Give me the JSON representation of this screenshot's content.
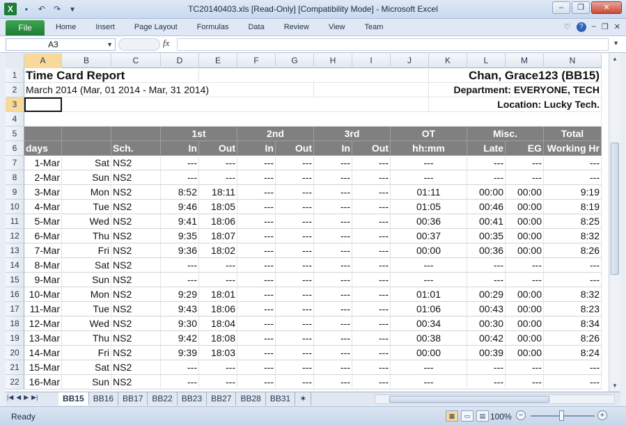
{
  "window": {
    "title": "TC20140403.xls  [Read-Only]  [Compatibility Mode]  -  Microsoft Excel",
    "app_icon_letter": "X"
  },
  "ribbon": {
    "file_label": "File",
    "tabs": [
      "Home",
      "Insert",
      "Page Layout",
      "Formulas",
      "Data",
      "Review",
      "View",
      "Team"
    ]
  },
  "formula_bar": {
    "name_box": "A3",
    "fx_label": "fx",
    "value": ""
  },
  "columns": [
    "A",
    "B",
    "C",
    "D",
    "E",
    "F",
    "G",
    "H",
    "I",
    "J",
    "K",
    "L",
    "M",
    "N"
  ],
  "report": {
    "title": "Time Card Report",
    "period": "March 2014 (Mar, 01 2014 - Mar, 31 2014)",
    "employee": "Chan, Grace123 (BB15)",
    "department": "Department: EVERYONE, TECH",
    "location": "Location: Lucky Tech."
  },
  "header_row5": {
    "first": "1st",
    "second": "2nd",
    "third": "3rd",
    "ot": "OT",
    "misc": "Misc.",
    "total": "Total"
  },
  "header_row6": {
    "days": "days",
    "sch": "Sch.",
    "in1": "In",
    "out1": "Out",
    "in2": "In",
    "out2": "Out",
    "in3": "In",
    "out3": "Out",
    "hhmm": "hh:mm",
    "late": "Late",
    "eg": "EG",
    "working": "Working Hr"
  },
  "rows": [
    {
      "n": "7",
      "date": "1-Mar",
      "day": "Sat",
      "sch": "NS2",
      "in1": "---",
      "out1": "---",
      "in2": "---",
      "out2": "---",
      "in3": "---",
      "out3": "---",
      "ot": "---",
      "late": "---",
      "eg": "---",
      "total": "---"
    },
    {
      "n": "8",
      "date": "2-Mar",
      "day": "Sun",
      "sch": "NS2",
      "in1": "---",
      "out1": "---",
      "in2": "---",
      "out2": "---",
      "in3": "---",
      "out3": "---",
      "ot": "---",
      "late": "---",
      "eg": "---",
      "total": "---"
    },
    {
      "n": "9",
      "date": "3-Mar",
      "day": "Mon",
      "sch": "NS2",
      "in1": "8:52",
      "out1": "18:11",
      "in2": "---",
      "out2": "---",
      "in3": "---",
      "out3": "---",
      "ot": "01:11",
      "late": "00:00",
      "eg": "00:00",
      "total": "9:19"
    },
    {
      "n": "10",
      "date": "4-Mar",
      "day": "Tue",
      "sch": "NS2",
      "in1": "9:46",
      "out1": "18:05",
      "in2": "---",
      "out2": "---",
      "in3": "---",
      "out3": "---",
      "ot": "01:05",
      "late": "00:46",
      "eg": "00:00",
      "total": "8:19"
    },
    {
      "n": "11",
      "date": "5-Mar",
      "day": "Wed",
      "sch": "NS2",
      "in1": "9:41",
      "out1": "18:06",
      "in2": "---",
      "out2": "---",
      "in3": "---",
      "out3": "---",
      "ot": "00:36",
      "late": "00:41",
      "eg": "00:00",
      "total": "8:25"
    },
    {
      "n": "12",
      "date": "6-Mar",
      "day": "Thu",
      "sch": "NS2",
      "in1": "9:35",
      "out1": "18:07",
      "in2": "---",
      "out2": "---",
      "in3": "---",
      "out3": "---",
      "ot": "00:37",
      "late": "00:35",
      "eg": "00:00",
      "total": "8:32"
    },
    {
      "n": "13",
      "date": "7-Mar",
      "day": "Fri",
      "sch": "NS2",
      "in1": "9:36",
      "out1": "18:02",
      "in2": "---",
      "out2": "---",
      "in3": "---",
      "out3": "---",
      "ot": "00:00",
      "late": "00:36",
      "eg": "00:00",
      "total": "8:26"
    },
    {
      "n": "14",
      "date": "8-Mar",
      "day": "Sat",
      "sch": "NS2",
      "in1": "---",
      "out1": "---",
      "in2": "---",
      "out2": "---",
      "in3": "---",
      "out3": "---",
      "ot": "---",
      "late": "---",
      "eg": "---",
      "total": "---"
    },
    {
      "n": "15",
      "date": "9-Mar",
      "day": "Sun",
      "sch": "NS2",
      "in1": "---",
      "out1": "---",
      "in2": "---",
      "out2": "---",
      "in3": "---",
      "out3": "---",
      "ot": "---",
      "late": "---",
      "eg": "---",
      "total": "---"
    },
    {
      "n": "16",
      "date": "10-Mar",
      "day": "Mon",
      "sch": "NS2",
      "in1": "9:29",
      "out1": "18:01",
      "in2": "---",
      "out2": "---",
      "in3": "---",
      "out3": "---",
      "ot": "01:01",
      "late": "00:29",
      "eg": "00:00",
      "total": "8:32"
    },
    {
      "n": "17",
      "date": "11-Mar",
      "day": "Tue",
      "sch": "NS2",
      "in1": "9:43",
      "out1": "18:06",
      "in2": "---",
      "out2": "---",
      "in3": "---",
      "out3": "---",
      "ot": "01:06",
      "late": "00:43",
      "eg": "00:00",
      "total": "8:23"
    },
    {
      "n": "18",
      "date": "12-Mar",
      "day": "Wed",
      "sch": "NS2",
      "in1": "9:30",
      "out1": "18:04",
      "in2": "---",
      "out2": "---",
      "in3": "---",
      "out3": "---",
      "ot": "00:34",
      "late": "00:30",
      "eg": "00:00",
      "total": "8:34"
    },
    {
      "n": "19",
      "date": "13-Mar",
      "day": "Thu",
      "sch": "NS2",
      "in1": "9:42",
      "out1": "18:08",
      "in2": "---",
      "out2": "---",
      "in3": "---",
      "out3": "---",
      "ot": "00:38",
      "late": "00:42",
      "eg": "00:00",
      "total": "8:26"
    },
    {
      "n": "20",
      "date": "14-Mar",
      "day": "Fri",
      "sch": "NS2",
      "in1": "9:39",
      "out1": "18:03",
      "in2": "---",
      "out2": "---",
      "in3": "---",
      "out3": "---",
      "ot": "00:00",
      "late": "00:39",
      "eg": "00:00",
      "total": "8:24"
    },
    {
      "n": "21",
      "date": "15-Mar",
      "day": "Sat",
      "sch": "NS2",
      "in1": "---",
      "out1": "---",
      "in2": "---",
      "out2": "---",
      "in3": "---",
      "out3": "---",
      "ot": "---",
      "late": "---",
      "eg": "---",
      "total": "---"
    },
    {
      "n": "22",
      "date": "16-Mar",
      "day": "Sun",
      "sch": "NS2",
      "in1": "---",
      "out1": "---",
      "in2": "---",
      "out2": "---",
      "in3": "---",
      "out3": "---",
      "ot": "---",
      "late": "---",
      "eg": "---",
      "total": "---"
    }
  ],
  "sheets": [
    "BB15",
    "BB16",
    "BB17",
    "BB22",
    "BB23",
    "BB27",
    "BB28",
    "BB31"
  ],
  "active_sheet": "BB15",
  "status": {
    "ready": "Ready",
    "zoom": "100%"
  },
  "colors": {
    "header_gray": "#808080",
    "file_tab_green": "#1e7b35",
    "active_header": "#f9d99a"
  }
}
